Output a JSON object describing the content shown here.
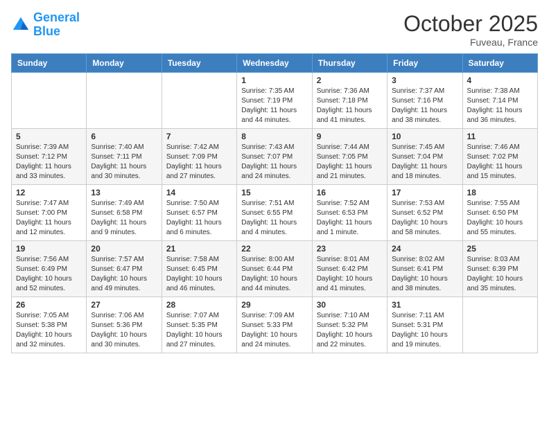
{
  "header": {
    "logo_line1": "General",
    "logo_line2": "Blue",
    "month": "October 2025",
    "location": "Fuveau, France"
  },
  "days_of_week": [
    "Sunday",
    "Monday",
    "Tuesday",
    "Wednesday",
    "Thursday",
    "Friday",
    "Saturday"
  ],
  "weeks": [
    [
      {
        "day": "",
        "sunrise": "",
        "sunset": "",
        "daylight": ""
      },
      {
        "day": "",
        "sunrise": "",
        "sunset": "",
        "daylight": ""
      },
      {
        "day": "",
        "sunrise": "",
        "sunset": "",
        "daylight": ""
      },
      {
        "day": "1",
        "sunrise": "Sunrise: 7:35 AM",
        "sunset": "Sunset: 7:19 PM",
        "daylight": "Daylight: 11 hours and 44 minutes."
      },
      {
        "day": "2",
        "sunrise": "Sunrise: 7:36 AM",
        "sunset": "Sunset: 7:18 PM",
        "daylight": "Daylight: 11 hours and 41 minutes."
      },
      {
        "day": "3",
        "sunrise": "Sunrise: 7:37 AM",
        "sunset": "Sunset: 7:16 PM",
        "daylight": "Daylight: 11 hours and 38 minutes."
      },
      {
        "day": "4",
        "sunrise": "Sunrise: 7:38 AM",
        "sunset": "Sunset: 7:14 PM",
        "daylight": "Daylight: 11 hours and 36 minutes."
      }
    ],
    [
      {
        "day": "5",
        "sunrise": "Sunrise: 7:39 AM",
        "sunset": "Sunset: 7:12 PM",
        "daylight": "Daylight: 11 hours and 33 minutes."
      },
      {
        "day": "6",
        "sunrise": "Sunrise: 7:40 AM",
        "sunset": "Sunset: 7:11 PM",
        "daylight": "Daylight: 11 hours and 30 minutes."
      },
      {
        "day": "7",
        "sunrise": "Sunrise: 7:42 AM",
        "sunset": "Sunset: 7:09 PM",
        "daylight": "Daylight: 11 hours and 27 minutes."
      },
      {
        "day": "8",
        "sunrise": "Sunrise: 7:43 AM",
        "sunset": "Sunset: 7:07 PM",
        "daylight": "Daylight: 11 hours and 24 minutes."
      },
      {
        "day": "9",
        "sunrise": "Sunrise: 7:44 AM",
        "sunset": "Sunset: 7:05 PM",
        "daylight": "Daylight: 11 hours and 21 minutes."
      },
      {
        "day": "10",
        "sunrise": "Sunrise: 7:45 AM",
        "sunset": "Sunset: 7:04 PM",
        "daylight": "Daylight: 11 hours and 18 minutes."
      },
      {
        "day": "11",
        "sunrise": "Sunrise: 7:46 AM",
        "sunset": "Sunset: 7:02 PM",
        "daylight": "Daylight: 11 hours and 15 minutes."
      }
    ],
    [
      {
        "day": "12",
        "sunrise": "Sunrise: 7:47 AM",
        "sunset": "Sunset: 7:00 PM",
        "daylight": "Daylight: 11 hours and 12 minutes."
      },
      {
        "day": "13",
        "sunrise": "Sunrise: 7:49 AM",
        "sunset": "Sunset: 6:58 PM",
        "daylight": "Daylight: 11 hours and 9 minutes."
      },
      {
        "day": "14",
        "sunrise": "Sunrise: 7:50 AM",
        "sunset": "Sunset: 6:57 PM",
        "daylight": "Daylight: 11 hours and 6 minutes."
      },
      {
        "day": "15",
        "sunrise": "Sunrise: 7:51 AM",
        "sunset": "Sunset: 6:55 PM",
        "daylight": "Daylight: 11 hours and 4 minutes."
      },
      {
        "day": "16",
        "sunrise": "Sunrise: 7:52 AM",
        "sunset": "Sunset: 6:53 PM",
        "daylight": "Daylight: 11 hours and 1 minute."
      },
      {
        "day": "17",
        "sunrise": "Sunrise: 7:53 AM",
        "sunset": "Sunset: 6:52 PM",
        "daylight": "Daylight: 10 hours and 58 minutes."
      },
      {
        "day": "18",
        "sunrise": "Sunrise: 7:55 AM",
        "sunset": "Sunset: 6:50 PM",
        "daylight": "Daylight: 10 hours and 55 minutes."
      }
    ],
    [
      {
        "day": "19",
        "sunrise": "Sunrise: 7:56 AM",
        "sunset": "Sunset: 6:49 PM",
        "daylight": "Daylight: 10 hours and 52 minutes."
      },
      {
        "day": "20",
        "sunrise": "Sunrise: 7:57 AM",
        "sunset": "Sunset: 6:47 PM",
        "daylight": "Daylight: 10 hours and 49 minutes."
      },
      {
        "day": "21",
        "sunrise": "Sunrise: 7:58 AM",
        "sunset": "Sunset: 6:45 PM",
        "daylight": "Daylight: 10 hours and 46 minutes."
      },
      {
        "day": "22",
        "sunrise": "Sunrise: 8:00 AM",
        "sunset": "Sunset: 6:44 PM",
        "daylight": "Daylight: 10 hours and 44 minutes."
      },
      {
        "day": "23",
        "sunrise": "Sunrise: 8:01 AM",
        "sunset": "Sunset: 6:42 PM",
        "daylight": "Daylight: 10 hours and 41 minutes."
      },
      {
        "day": "24",
        "sunrise": "Sunrise: 8:02 AM",
        "sunset": "Sunset: 6:41 PM",
        "daylight": "Daylight: 10 hours and 38 minutes."
      },
      {
        "day": "25",
        "sunrise": "Sunrise: 8:03 AM",
        "sunset": "Sunset: 6:39 PM",
        "daylight": "Daylight: 10 hours and 35 minutes."
      }
    ],
    [
      {
        "day": "26",
        "sunrise": "Sunrise: 7:05 AM",
        "sunset": "Sunset: 5:38 PM",
        "daylight": "Daylight: 10 hours and 32 minutes."
      },
      {
        "day": "27",
        "sunrise": "Sunrise: 7:06 AM",
        "sunset": "Sunset: 5:36 PM",
        "daylight": "Daylight: 10 hours and 30 minutes."
      },
      {
        "day": "28",
        "sunrise": "Sunrise: 7:07 AM",
        "sunset": "Sunset: 5:35 PM",
        "daylight": "Daylight: 10 hours and 27 minutes."
      },
      {
        "day": "29",
        "sunrise": "Sunrise: 7:09 AM",
        "sunset": "Sunset: 5:33 PM",
        "daylight": "Daylight: 10 hours and 24 minutes."
      },
      {
        "day": "30",
        "sunrise": "Sunrise: 7:10 AM",
        "sunset": "Sunset: 5:32 PM",
        "daylight": "Daylight: 10 hours and 22 minutes."
      },
      {
        "day": "31",
        "sunrise": "Sunrise: 7:11 AM",
        "sunset": "Sunset: 5:31 PM",
        "daylight": "Daylight: 10 hours and 19 minutes."
      },
      {
        "day": "",
        "sunrise": "",
        "sunset": "",
        "daylight": ""
      }
    ]
  ]
}
